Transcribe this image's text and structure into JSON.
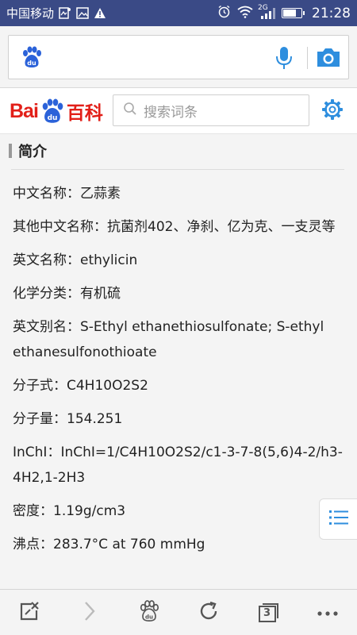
{
  "status_bar": {
    "carrier": "中国移动",
    "network": "2G",
    "time": "21:28",
    "battery_level": 0.75
  },
  "baike": {
    "logo_bai": "Bai",
    "logo_baike": "百科",
    "search_placeholder": "搜索词条"
  },
  "section": {
    "title": "简介"
  },
  "items": [
    {
      "label": "中文名称：",
      "value": "乙蒜素"
    },
    {
      "label": "其他中文名称：",
      "value": "抗菌剂402、净刹、亿为克、一支灵等"
    },
    {
      "label": "英文名称：",
      "value": "ethylicin"
    },
    {
      "label": "化学分类：",
      "value": "有机硫"
    },
    {
      "label": "英文别名：",
      "value": "S-Ethyl ethanethiosulfonate; S-ethyl ethanesulfonothioate"
    },
    {
      "label": "分子式：",
      "value": "C4H10O2S2"
    },
    {
      "label": "分子量：",
      "value": "154.251"
    },
    {
      "label": "InChI：",
      "value": "InChI=1/C4H10O2S2/c1-3-7-8(5,6)4-2/h3-4H2,1-2H3"
    },
    {
      "label": "密度：",
      "value": "1.19g/cm3"
    },
    {
      "label": "沸点：",
      "value": "283.7°C at 760 mmHg"
    }
  ],
  "bottom_nav": {
    "tabs_count": "3"
  },
  "colors": {
    "status_bar": "#3a4a86",
    "accent_blue": "#2e8ede",
    "baidu_red": "#e21f18",
    "baidu_blue": "#2b62d9"
  }
}
